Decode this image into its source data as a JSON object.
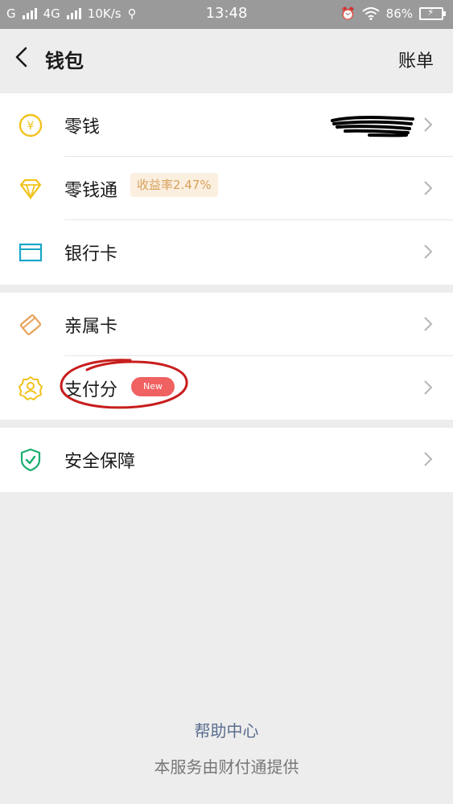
{
  "status_bar": {
    "carrier1": "G",
    "carrier2": "4G",
    "speed": "10K/s",
    "time": "13:48",
    "battery": "86%"
  },
  "header": {
    "title": "钱包",
    "bill_label": "账单"
  },
  "rows": {
    "change": {
      "label": "零钱",
      "icon": "yuan-coin-icon"
    },
    "lingqiantong": {
      "label": "零钱通",
      "badge": "收益率2.47%",
      "icon": "diamond-icon"
    },
    "bank_card": {
      "label": "银行卡",
      "icon": "card-icon"
    },
    "family_card": {
      "label": "亲属卡",
      "icon": "family-card-icon"
    },
    "pay_score": {
      "label": "支付分",
      "badge": "New",
      "icon": "score-badge-icon"
    },
    "security": {
      "label": "安全保障",
      "icon": "shield-icon"
    }
  },
  "footer": {
    "help": "帮助中心",
    "provider": "本服务由财付通提供"
  },
  "colors": {
    "yellow": "#f2c21b",
    "cyan": "#1aa6c8",
    "orange": "#e8a25a",
    "green": "#1aad6f",
    "new_badge": "#f06161"
  }
}
